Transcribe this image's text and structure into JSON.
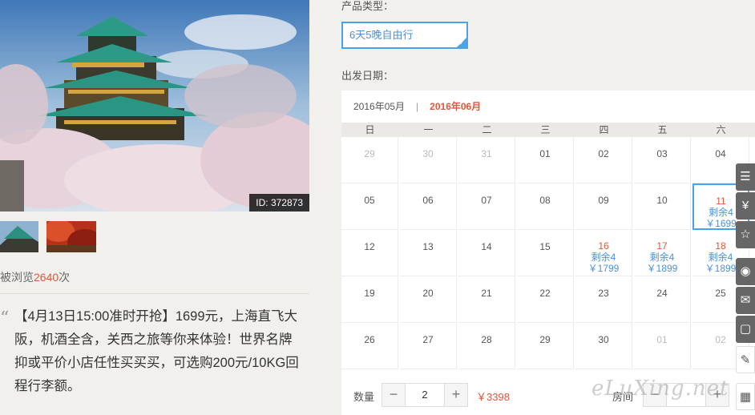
{
  "gallery": {
    "image_id": "ID: 372873"
  },
  "views": {
    "prefix": "被浏览",
    "count": "2640",
    "suffix": "次"
  },
  "description": "【4月13日15:00准时开抢】1699元，上海直飞大阪，机酒全含，关西之旅等你来体验！世界名牌抑或平价小店任性买买买，可选购200元/10KG回程行李额。",
  "product": {
    "label": "产品类型：",
    "option": "6天5晚自由行"
  },
  "date_label": "出发日期：",
  "calendar": {
    "prev_month": "2016年05月",
    "separator": "|",
    "current_month": "2016年06月",
    "weekdays": [
      "日",
      "一",
      "二",
      "三",
      "四",
      "五",
      "六"
    ],
    "weeks": [
      [
        {
          "d": "29",
          "m": true
        },
        {
          "d": "30",
          "m": true
        },
        {
          "d": "31",
          "m": true
        },
        {
          "d": "01"
        },
        {
          "d": "02"
        },
        {
          "d": "03"
        },
        {
          "d": "04"
        }
      ],
      [
        {
          "d": "05"
        },
        {
          "d": "06"
        },
        {
          "d": "07"
        },
        {
          "d": "08"
        },
        {
          "d": "09"
        },
        {
          "d": "10"
        },
        {
          "d": "11",
          "rem": "剩余4",
          "price": "￥1699",
          "sel": true
        }
      ],
      [
        {
          "d": "12"
        },
        {
          "d": "13"
        },
        {
          "d": "14"
        },
        {
          "d": "15"
        },
        {
          "d": "16",
          "rem": "剩余4",
          "price": "￥1799"
        },
        {
          "d": "17",
          "rem": "剩余4",
          "price": "￥1899"
        },
        {
          "d": "18",
          "rem": "剩余4",
          "price": "￥1899"
        }
      ],
      [
        {
          "d": "19"
        },
        {
          "d": "20"
        },
        {
          "d": "21"
        },
        {
          "d": "22"
        },
        {
          "d": "23"
        },
        {
          "d": "24"
        },
        {
          "d": "25"
        }
      ],
      [
        {
          "d": "26"
        },
        {
          "d": "27"
        },
        {
          "d": "28"
        },
        {
          "d": "29"
        },
        {
          "d": "30"
        },
        {
          "d": "01",
          "m": true
        },
        {
          "d": "02",
          "m": true
        }
      ]
    ]
  },
  "quantity": {
    "label": "数量",
    "minus": "−",
    "value": "2",
    "plus": "+",
    "total": "￥3398"
  },
  "room": {
    "label": "房间",
    "minus": "−",
    "plus": "+"
  },
  "sidebar_icons": [
    "list-icon",
    "yen-icon",
    "star-icon",
    "weibo-icon",
    "wechat-icon",
    "square-icon",
    "edit-icon",
    "qrcode-icon"
  ],
  "watermark": "eLuXing.net",
  "colors": {
    "accent_blue": "#4aa3e8",
    "price_red": "#e4553a"
  }
}
